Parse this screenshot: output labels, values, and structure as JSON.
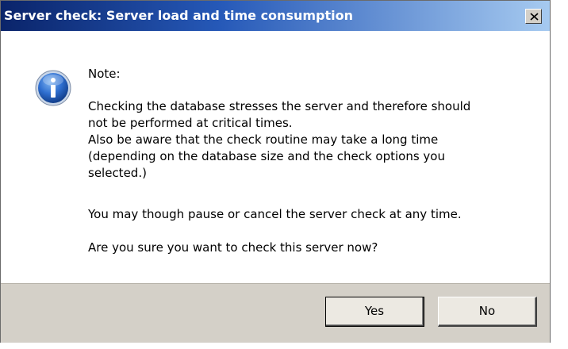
{
  "dialog": {
    "title": "Server check: Server load and time consumption",
    "close_icon": "close-icon",
    "icon": "information-icon",
    "note_label": "Note:",
    "message_lines": [
      "Checking the database stresses the server and therefore should",
      "not be performed at critical times.",
      "Also be aware that the check routine may take a long time",
      "(depending on the database size and the check options you",
      "selected.)"
    ],
    "pause_text": "You may though pause or cancel the server check at any time.",
    "question": "Are you sure you want to check this server now?",
    "buttons": {
      "yes": "Yes",
      "no": "No"
    }
  },
  "colors": {
    "title_start": "#0a246a",
    "title_end": "#a6caf0",
    "footer_bg": "#d4d0c8",
    "icon_blue": "#1d5fbf"
  }
}
